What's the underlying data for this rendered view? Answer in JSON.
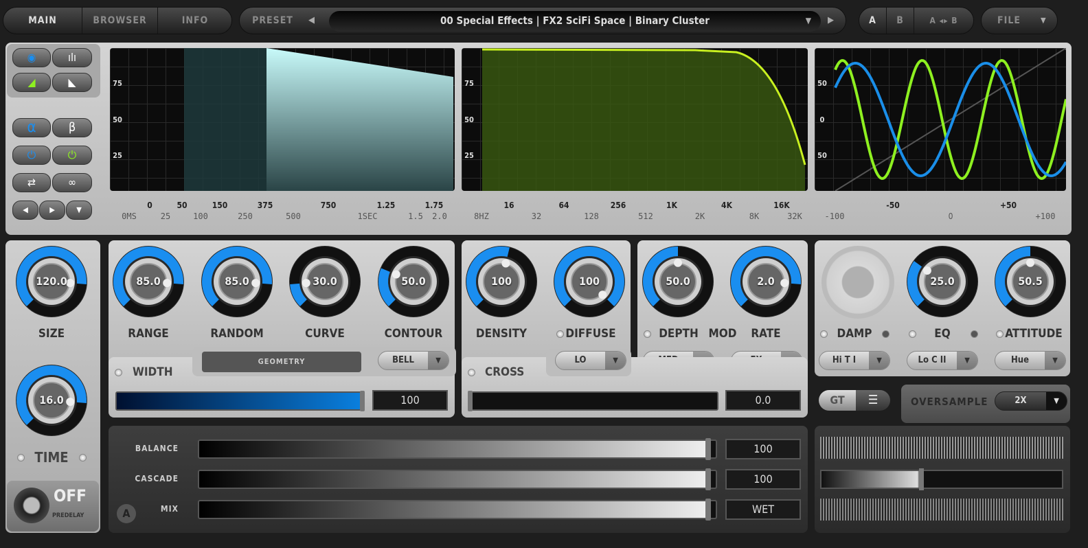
{
  "topbar": {
    "tabs": [
      "MAIN",
      "BROWSER",
      "INFO"
    ],
    "active_tab": "MAIN",
    "preset_label": "PRESET",
    "preset_name": "00 Special Effects | FX2 SciFi Space | Binary Cluster",
    "ab": [
      "A",
      "B",
      "A ◂▸ B"
    ],
    "file_label": "FILE"
  },
  "graphs": {
    "time": {
      "y_ticks": [
        "75",
        "50",
        "25"
      ],
      "major": [
        "0",
        "50",
        "150",
        "375",
        "750",
        "1.25",
        "1.75"
      ],
      "minor": [
        "0MS",
        "25",
        "100",
        "250",
        "500",
        "1SEC",
        "1.5",
        "2.0"
      ],
      "colors": {
        "fill": "#bff4f4",
        "dark": "#1e3a3c"
      }
    },
    "freq": {
      "y_ticks": [
        "75",
        "50",
        "25"
      ],
      "major": [
        "16",
        "64",
        "256",
        "1K",
        "4K",
        "16K"
      ],
      "minor": [
        "8HZ",
        "32",
        "128",
        "512",
        "2K",
        "8K",
        "32K"
      ],
      "colors": {
        "curve": "#c8f020",
        "fill": "#3a5a10"
      }
    },
    "stereo": {
      "y_ticks": [
        "50",
        "0",
        "50"
      ],
      "major": [
        "-50",
        "0",
        "+50"
      ],
      "minor": [
        "-100",
        "+100"
      ],
      "colors": {
        "green": "#8ef020",
        "blue": "#1a8ee8"
      }
    }
  },
  "knobs": [
    {
      "id": "size",
      "label": "SIZE",
      "value": "120.0",
      "level": 0.85
    },
    {
      "id": "range",
      "label": "RANGE",
      "value": "85.0",
      "level": 0.85
    },
    {
      "id": "random",
      "label": "RANDOM",
      "value": "85.0",
      "level": 0.85
    },
    {
      "id": "curve",
      "label": "CURVE",
      "value": "30.0",
      "level": 0.15
    },
    {
      "id": "contour",
      "label": "CONTOUR",
      "value": "50.0",
      "level": 0.25
    },
    {
      "id": "density",
      "label": "DENSITY",
      "value": "100",
      "level": 0.55
    },
    {
      "id": "diffuse",
      "label": "DIFFUSE",
      "value": "100",
      "level": 1.0
    },
    {
      "id": "depth",
      "label": "DEPTH",
      "value": "50.0",
      "level": 0.5
    },
    {
      "id": "rate",
      "label": "RATE",
      "value": "2.0",
      "level": 0.85
    },
    {
      "id": "eq",
      "label": "EQ",
      "value": "25.0",
      "level": 0.3
    },
    {
      "id": "attitude",
      "label": "ATTITUDE",
      "value": "50.5",
      "level": 0.5
    },
    {
      "id": "time",
      "label": "TIME",
      "value": "16.0",
      "level": 0.85
    }
  ],
  "mod_label": "MOD",
  "damp_label": "DAMP",
  "dropdowns": {
    "bell": "BELL",
    "lo": "LO",
    "med": "MED",
    "fx": "FX",
    "damp": "Hi T I",
    "eq": "Lo C II",
    "attitude": "Hue",
    "oversample": "2X"
  },
  "geometry_label": "GEOMETRY",
  "width": {
    "label": "WIDTH",
    "value": "100",
    "level": 1.0
  },
  "cross": {
    "label": "CROSS",
    "value": "0.0",
    "level": 0.0
  },
  "oversample_label": "OVERSAMPLE",
  "predelay": {
    "state": "OFF",
    "label": "PREDELAY"
  },
  "sliders": [
    {
      "label": "BALANCE",
      "value": "100",
      "level": 1.0
    },
    {
      "label": "CASCADE",
      "value": "100",
      "level": 1.0
    },
    {
      "label": "MIX",
      "value": "WET",
      "level": 1.0
    }
  ],
  "side_buttons": {
    "alpha": "α",
    "beta": "β"
  },
  "accent": "#1a8ef0"
}
